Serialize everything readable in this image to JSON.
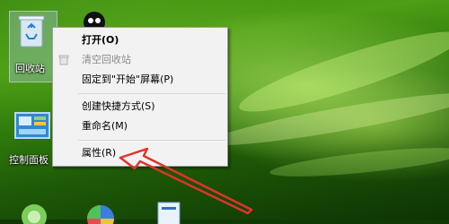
{
  "desktop": {
    "icons": [
      {
        "name": "recycle-bin",
        "label": "回收站"
      },
      {
        "name": "control-panel",
        "label": "控制面板"
      }
    ]
  },
  "context_menu": {
    "items": [
      {
        "label": "打开(O)",
        "bold": true,
        "disabled": false
      },
      {
        "label": "清空回收站",
        "bold": false,
        "disabled": true
      },
      {
        "label": "固定到\"开始\"屏幕(P)",
        "bold": false,
        "disabled": false
      },
      {
        "label": "创建快捷方式(S)",
        "bold": false,
        "disabled": false
      },
      {
        "label": "重命名(M)",
        "bold": false,
        "disabled": false
      },
      {
        "label": "属性(R)",
        "bold": false,
        "disabled": false
      }
    ]
  },
  "annotation": {
    "color": "#e0332a"
  }
}
